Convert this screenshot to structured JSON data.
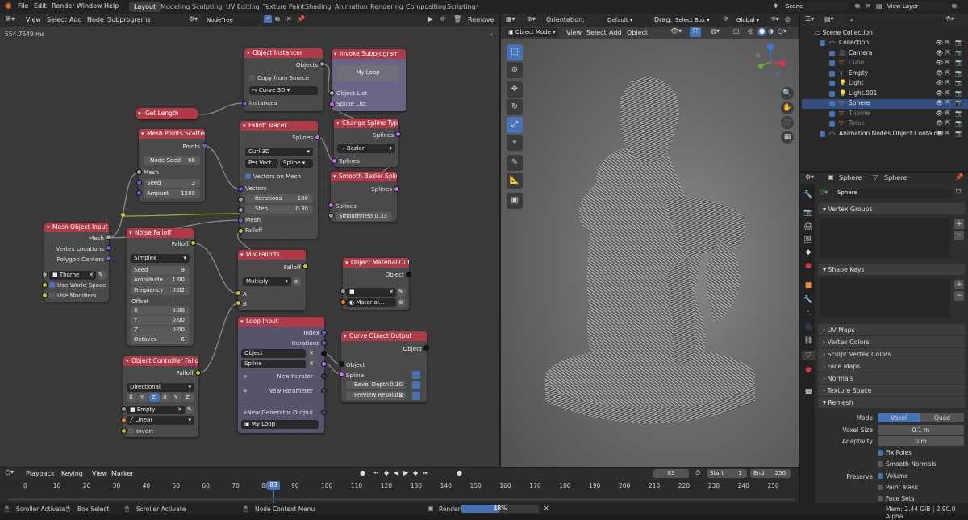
{
  "topbar": {
    "menus": [
      "File",
      "Edit",
      "Render",
      "Window",
      "Help"
    ],
    "workspaces": [
      "Layout",
      "Modeling",
      "Sculpting",
      "UV Editing",
      "Texture Paint",
      "Shading",
      "Animation",
      "Rendering",
      "Compositing",
      "Scripting"
    ],
    "scene": "Scene",
    "view_layer": "View Layer"
  },
  "node_editor": {
    "menus": [
      "View",
      "Select",
      "Add",
      "Node",
      "Subprograms"
    ],
    "tree_name": "NodeTree",
    "remove_label": "Remove",
    "execution_time": "554.7549 ms"
  },
  "nodes": {
    "object_instancer": {
      "title": "Object Instancer",
      "objects": "Objects",
      "copy_from_source": "Copy from Source",
      "curve": "Curve 3D",
      "instances": "Instances"
    },
    "invoke_subprogram": {
      "title": "Invoke Subprogram",
      "loop": "My Loop",
      "object_list": "Object List",
      "spline_list": "Spline List"
    },
    "get_length": {
      "title": "Get Length"
    },
    "mesh_points_scatter": {
      "title": "Mesh Points Scatter",
      "points": "Points",
      "node_seed_label": "Node Seed",
      "node_seed": "66",
      "mesh": "Mesh",
      "seed_label": "Seed",
      "seed": "3",
      "amount_label": "Amount",
      "amount": "1500"
    },
    "falloff_tracer": {
      "title": "Falloff Tracer",
      "splines": "Splines",
      "curve": "Curl 3D",
      "per_vector": "Per Vect...",
      "spline": "Spline",
      "vectors_on_mesh": "Vectors on Mesh",
      "vectors": "Vectors",
      "iterations_label": "Iterations",
      "iterations": "100",
      "step_label": "Step",
      "step": "0.30",
      "mesh": "Mesh",
      "falloff": "Falloff"
    },
    "change_spline_type": {
      "title": "Change Spline Type",
      "splines_out": "Splines",
      "type": "Bezier",
      "splines_in": "Splines"
    },
    "smooth_bezier": {
      "title": "Smooth Bezier Spline",
      "splines_out": "Splines",
      "splines_in": "Splines",
      "smoothness_label": "Smoothness",
      "smoothness": "0.33"
    },
    "mesh_object_input": {
      "title": "Mesh Object Input",
      "mesh": "Mesh",
      "vertex_locations": "Vertex Locations",
      "polygon_centers": "Polygon Centers",
      "object": "Thorne",
      "use_world_space": "Use World Space",
      "use_modifiers": "Use Modifiers"
    },
    "noise_falloff": {
      "title": "Noise Falloff",
      "falloff": "Falloff",
      "type": "Simplex",
      "seed_label": "Seed",
      "seed": "9",
      "amplitude_label": "Amplitude",
      "amplitude": "1.00",
      "frequency_label": "Frequency",
      "frequency": "0.02",
      "offset": "Offset",
      "x_label": "X",
      "x": "0.00",
      "y_label": "Y",
      "y": "0.00",
      "z_label": "Z",
      "z": "0.00",
      "octaves_label": "Octaves",
      "octaves": "6"
    },
    "mix_falloffs": {
      "title": "Mix Falloffs",
      "falloff": "Falloff",
      "mode": "Multiply",
      "a": "A",
      "b": "B"
    },
    "object_material_output": {
      "title": "Object Material Out...",
      "object": "Object",
      "material": "Material..."
    },
    "loop_input": {
      "title": "Loop Input",
      "index": "Index",
      "iterations": "Iterations",
      "object": "Object",
      "spline": "Spline",
      "new_iterator": "New Iterator",
      "new_parameter": "New Parameter",
      "new_generator": "New Generator Output",
      "loop_name": "My Loop"
    },
    "curve_object_output": {
      "title": "Curve Object Output",
      "object_out": "Object",
      "object_in": "Object",
      "spline": "Spline",
      "bevel_label": "Bevel Depth",
      "bevel": "0.10",
      "preview_label": "Preview Resolutio",
      "preview": "3"
    },
    "object_controller_falloff": {
      "title": "Object Controller Falloff",
      "falloff": "Falloff",
      "mode": "Directional",
      "axes": [
        "X",
        "Y",
        "Z",
        "X",
        "Y",
        "Z"
      ],
      "object": "Empty",
      "interp": "Linear",
      "invert": "Invert"
    }
  },
  "viewport": {
    "orientation_label": "Orientation:",
    "orientation": "Default",
    "drag_label": "Drag:",
    "drag": "Select Box",
    "transform": "Global",
    "mode": "Object Mode",
    "menus": [
      "View",
      "Select",
      "Add",
      "Object"
    ]
  },
  "outliner": {
    "search_placeholder": "",
    "collection": "Scene Collection",
    "items": [
      {
        "name": "Collection",
        "icon": "collection-icon"
      },
      {
        "name": "Camera",
        "icon": "camera-icon"
      },
      {
        "name": "Cube",
        "icon": "mesh-icon"
      },
      {
        "name": "Empty",
        "icon": "empty-icon"
      },
      {
        "name": "Light",
        "icon": "light-icon"
      },
      {
        "name": "Light.001",
        "icon": "light-icon"
      },
      {
        "name": "Sphere",
        "icon": "mesh-icon"
      },
      {
        "name": "Thorne",
        "icon": "mesh-icon"
      },
      {
        "name": "Torus",
        "icon": "mesh-icon"
      },
      {
        "name": "Animation Nodes Object Container",
        "icon": "collection-icon"
      }
    ]
  },
  "properties": {
    "object": "Sphere",
    "data": "Sphere",
    "mesh_name": "Sphere",
    "sections": [
      "Vertex Groups",
      "Shape Keys",
      "UV Maps",
      "Vertex Colors",
      "Sculpt Vertex Colors",
      "Face Maps",
      "Normals",
      "Texture Space",
      "Remesh"
    ],
    "remesh": {
      "mode_label": "Mode",
      "voxel": "Voxel",
      "quad": "Quad",
      "voxel_size_label": "Voxel Size",
      "voxel_size": "0.1 m",
      "adaptivity_label": "Adaptivity",
      "adaptivity": "0 m",
      "fix_poles": "Fix Poles",
      "smooth_normals": "Smooth Normals",
      "preserve_label": "Preserve",
      "volume": "Volume",
      "paint_mask": "Paint Mask",
      "face_sets": "Face Sets"
    }
  },
  "timeline": {
    "menus": [
      "Playback",
      "Keying",
      "View",
      "Marker"
    ],
    "current_frame": "83",
    "start_label": "Start",
    "start": "1",
    "end_label": "End",
    "end": "250",
    "ticks": [
      "0",
      "10",
      "20",
      "30",
      "40",
      "50",
      "60",
      "70",
      "80",
      "90",
      "100",
      "110",
      "120",
      "130",
      "140",
      "150",
      "160",
      "170",
      "180",
      "190",
      "200",
      "210",
      "220",
      "230",
      "240",
      "250"
    ],
    "playhead": "83"
  },
  "statusbar": {
    "scroller": "Scroller Activate",
    "box_select": "Box Select",
    "scroller2": "Scroller Activate",
    "node_context": "Node Context Menu",
    "render_label": "Render",
    "render_progress": "48%",
    "render_fraction": 0.48,
    "memory": "Mem: 2.44 GiB | 2.90.0 Alpha"
  },
  "colors": {
    "node_header": "#b13a48",
    "accent": "#4772b3",
    "socket_gray": "#a1a1a1",
    "socket_purple": "#c572e6",
    "socket_blue": "#6363c7",
    "socket_yellow": "#c7c729"
  }
}
